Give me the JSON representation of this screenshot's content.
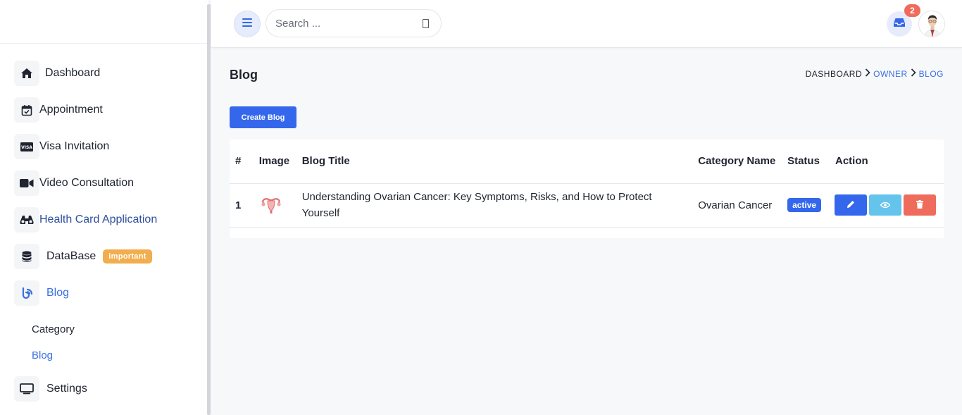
{
  "sidebar": {
    "items": [
      {
        "label": "Dashboard"
      },
      {
        "label": "Appointment"
      },
      {
        "label": "Visa Invitation"
      },
      {
        "label": "Video Consultation"
      },
      {
        "label": "Health Card Application"
      },
      {
        "label": "DataBase",
        "badge": "important"
      },
      {
        "label": "Blog"
      },
      {
        "label": "Settings"
      }
    ],
    "blog_sub": [
      {
        "label": "Category"
      },
      {
        "label": "Blog"
      }
    ]
  },
  "header": {
    "search_placeholder": "Search ...",
    "notification_count": "2"
  },
  "page": {
    "title": "Blog",
    "breadcrumb": [
      "DASHBOARD",
      "OWNER",
      "BLOG"
    ],
    "create_button": "Create Blog"
  },
  "table": {
    "headers": [
      "#",
      "Image",
      "Blog Title",
      "Category Name",
      "Status",
      "Action"
    ],
    "rows": [
      {
        "index": "1",
        "title": "Understanding Ovarian Cancer: Key Symptoms, Risks, and How to Protect Yourself",
        "category": "Ovarian Cancer",
        "status": "active"
      }
    ]
  },
  "colors": {
    "accent": "#3467eb",
    "view": "#64c4ec",
    "delete": "#ef6b5b",
    "badge_important": "#f2ad4e"
  }
}
